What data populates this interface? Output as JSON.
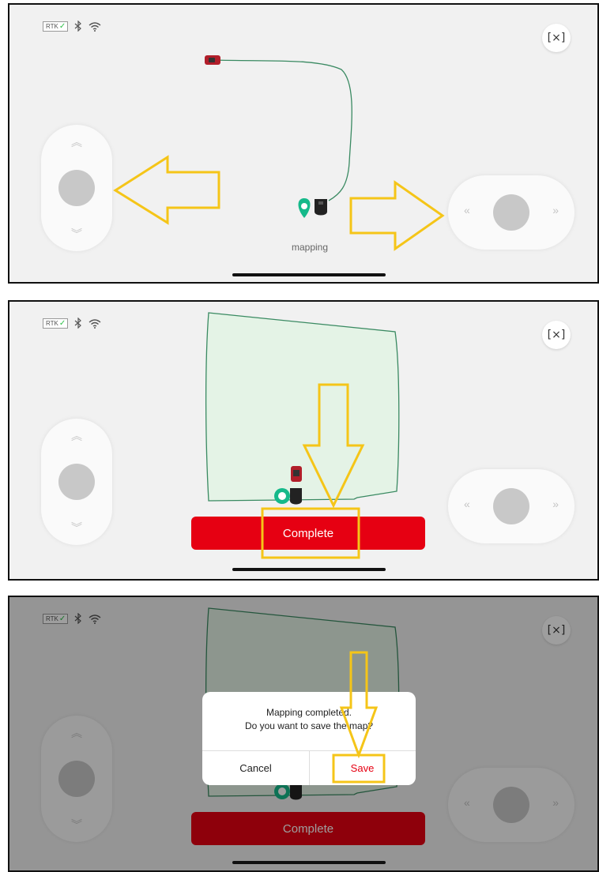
{
  "status_bar": {
    "rtk_label": "RTK"
  },
  "icons": {
    "close": "[×]",
    "up": "︽",
    "down": "︾",
    "left": "«",
    "right": "»"
  },
  "panel1": {
    "status_text": "mapping"
  },
  "panel2": {
    "complete_label": "Complete"
  },
  "panel3": {
    "complete_label": "Complete",
    "dialog": {
      "line1": "Mapping completed.",
      "line2": "Do you want to save the map?",
      "cancel_label": "Cancel",
      "save_label": "Save"
    }
  },
  "colors": {
    "accent_red": "#e60012",
    "annotation_yellow": "#f5c518",
    "map_green": "#2f7d55",
    "marker_teal": "#15b98a"
  }
}
